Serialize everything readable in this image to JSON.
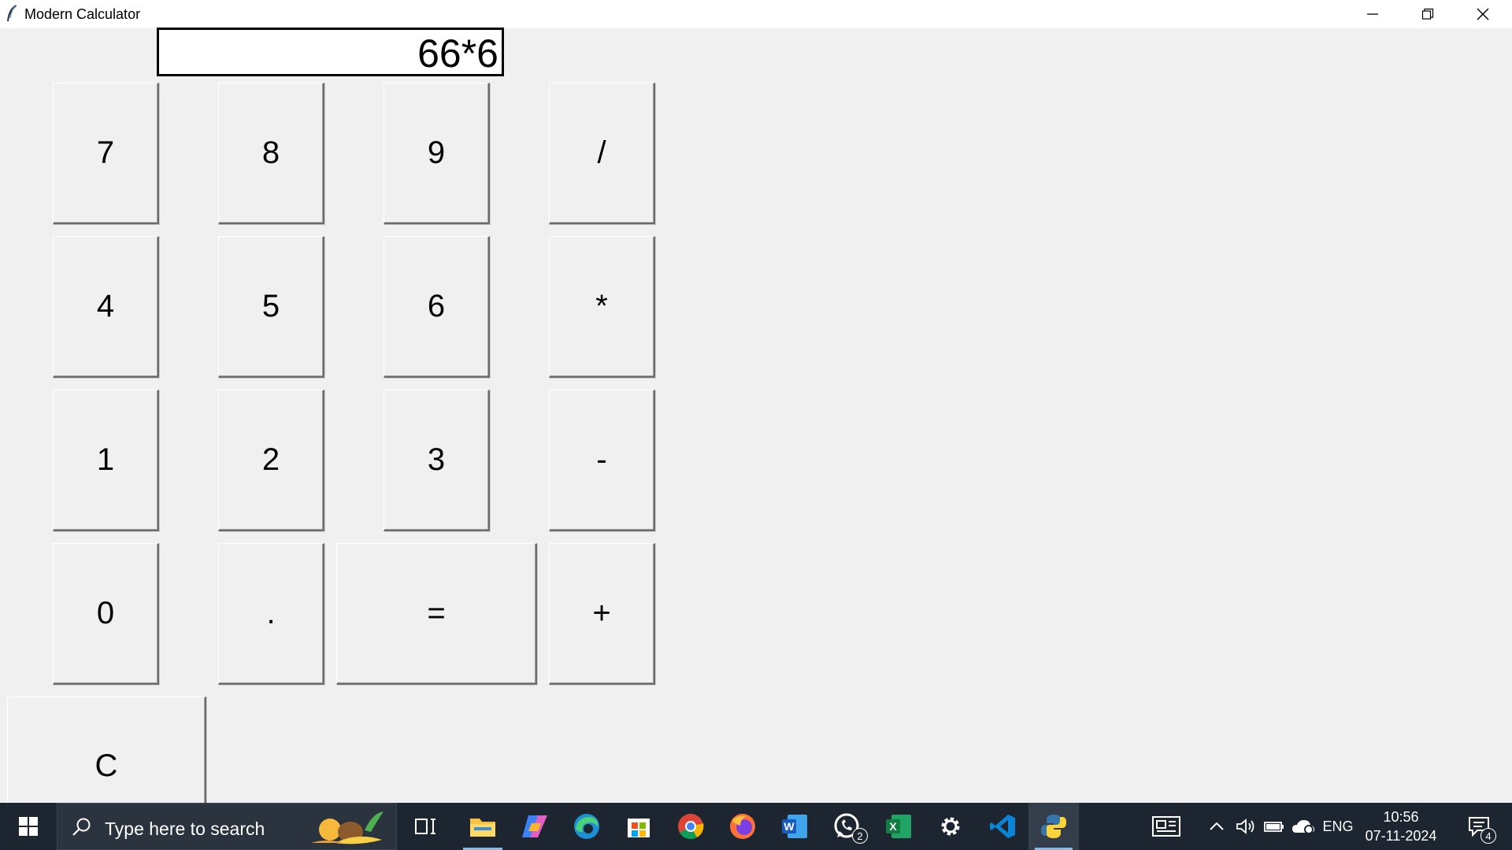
{
  "window": {
    "title": "Modern Calculator"
  },
  "display": {
    "expression": "66*6"
  },
  "keypad": {
    "k7": "7",
    "k8": "8",
    "k9": "9",
    "div": "/",
    "k4": "4",
    "k5": "5",
    "k6": "6",
    "mul": "*",
    "k1": "1",
    "k2": "2",
    "k3": "3",
    "sub": "-",
    "k0": "0",
    "dot": ".",
    "eq": "=",
    "add": "+",
    "clear": "C"
  },
  "taskbar": {
    "search_placeholder": "Type here to search",
    "whatsapp_badge": "2",
    "language": "ENG",
    "time": "10:56",
    "date": "07-11-2024",
    "notification_count": "4",
    "colors": {
      "background": "#1c2530",
      "accent": "#8cb8e8"
    },
    "icons": [
      "windows-start-icon",
      "search-icon",
      "task-view-icon",
      "file-explorer-icon",
      "copilot-icon",
      "edge-icon",
      "microsoft-store-icon",
      "chrome-icon",
      "firefox-icon",
      "word-icon",
      "whatsapp-icon",
      "excel-icon",
      "settings-icon",
      "vscode-icon",
      "python-icon"
    ]
  }
}
